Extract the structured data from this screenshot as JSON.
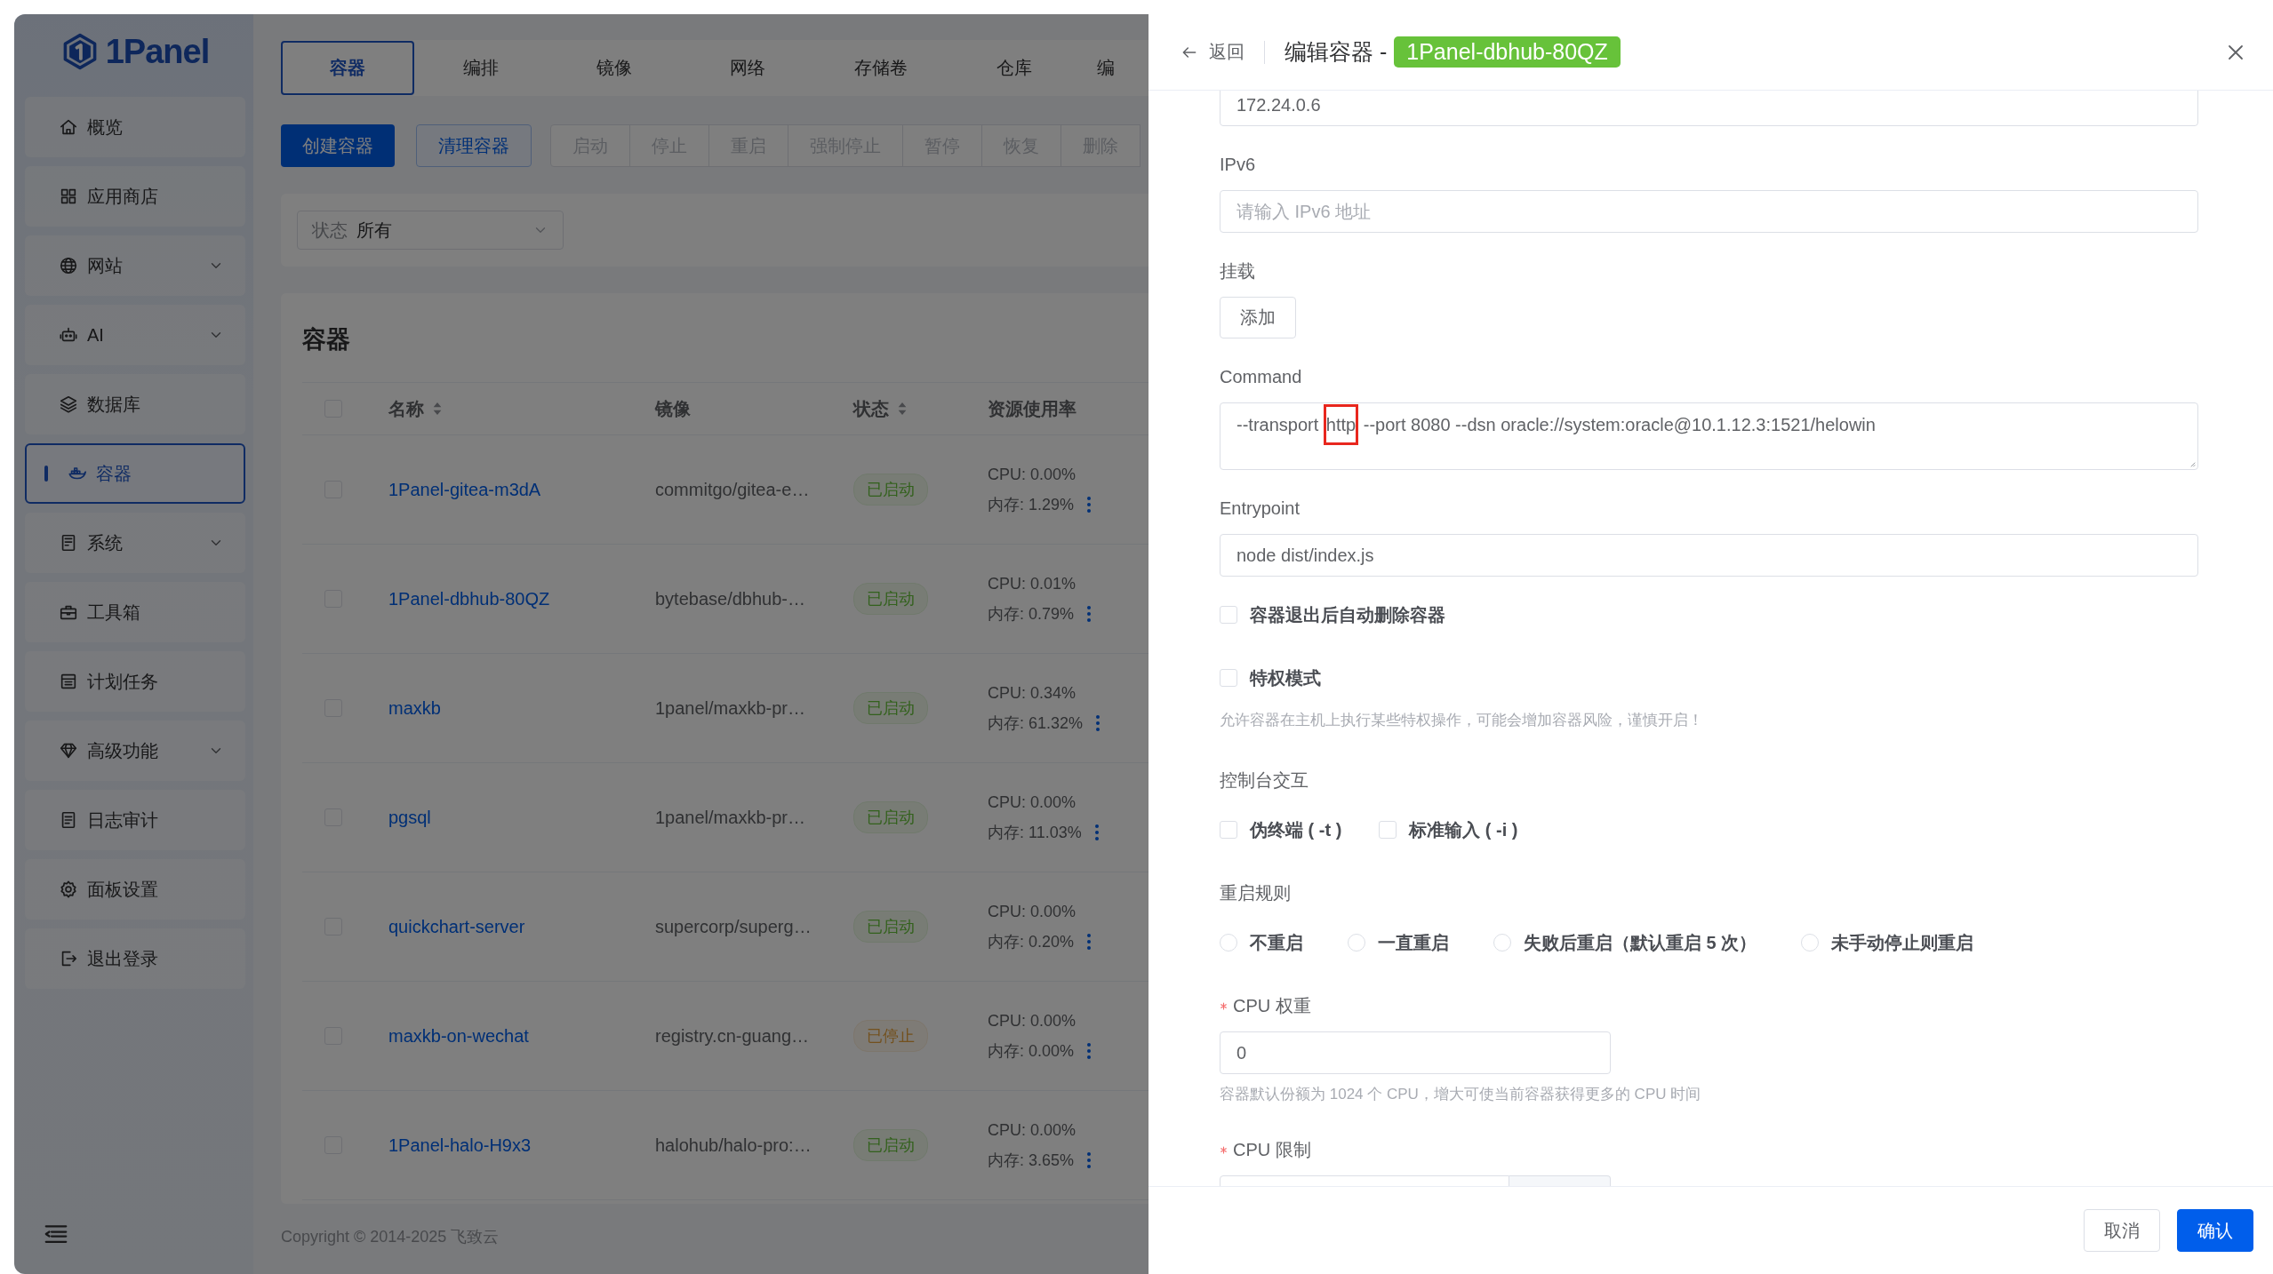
{
  "sidebar": {
    "logo": "1Panel",
    "items": [
      {
        "label": "概览",
        "expandable": false,
        "selected": false
      },
      {
        "label": "应用商店",
        "expandable": false,
        "selected": false
      },
      {
        "label": "网站",
        "expandable": true,
        "selected": false
      },
      {
        "label": "AI",
        "expandable": true,
        "selected": false
      },
      {
        "label": "数据库",
        "expandable": false,
        "selected": false
      },
      {
        "label": "容器",
        "expandable": false,
        "selected": true
      },
      {
        "label": "系统",
        "expandable": true,
        "selected": false
      },
      {
        "label": "工具箱",
        "expandable": false,
        "selected": false
      },
      {
        "label": "计划任务",
        "expandable": false,
        "selected": false
      },
      {
        "label": "高级功能",
        "expandable": true,
        "selected": false
      },
      {
        "label": "日志审计",
        "expandable": false,
        "selected": false
      },
      {
        "label": "面板设置",
        "expandable": false,
        "selected": false
      },
      {
        "label": "退出登录",
        "expandable": false,
        "selected": false
      }
    ]
  },
  "tabs": [
    {
      "label": "容器",
      "selected": true
    },
    {
      "label": "编排",
      "selected": false
    },
    {
      "label": "镜像",
      "selected": false
    },
    {
      "label": "网络",
      "selected": false
    },
    {
      "label": "存储卷",
      "selected": false
    },
    {
      "label": "仓库",
      "selected": false
    },
    {
      "label": "编",
      "selected": false
    }
  ],
  "toolbar": {
    "primary": "创建容器",
    "secondary": "清理容器",
    "actions": [
      {
        "label": "启动",
        "disabled": true
      },
      {
        "label": "停止",
        "disabled": true
      },
      {
        "label": "重启",
        "disabled": true
      },
      {
        "label": "强制停止",
        "disabled": true
      },
      {
        "label": "暂停",
        "disabled": true
      },
      {
        "label": "恢复",
        "disabled": true
      },
      {
        "label": "删除",
        "disabled": true
      }
    ]
  },
  "filter": {
    "label": "状态",
    "value": "所有"
  },
  "table": {
    "title": "容器",
    "select_all_checked": false,
    "columns": [
      {
        "label": "名称",
        "sortable": true
      },
      {
        "label": "镜像",
        "sortable": false
      },
      {
        "label": "状态",
        "sortable": true
      },
      {
        "label": "资源使用率",
        "sortable": false
      }
    ],
    "rows": [
      {
        "checked": false,
        "name": "1Panel-gitea-m3dA",
        "image": "commitgo/gitea-e…",
        "status": "已启动",
        "running": true,
        "cpu": "CPU: 0.00%",
        "memory": "内存: 1.29%"
      },
      {
        "checked": false,
        "name": "1Panel-dbhub-80QZ",
        "image": "bytebase/dbhub-…",
        "status": "已启动",
        "running": true,
        "cpu": "CPU: 0.01%",
        "memory": "内存: 0.79%"
      },
      {
        "checked": false,
        "name": "maxkb",
        "image": "1panel/maxkb-pr…",
        "status": "已启动",
        "running": true,
        "cpu": "CPU: 0.34%",
        "memory": "内存: 61.32%"
      },
      {
        "checked": false,
        "name": "pgsql",
        "image": "1panel/maxkb-pr…",
        "status": "已启动",
        "running": true,
        "cpu": "CPU: 0.00%",
        "memory": "内存: 11.03%"
      },
      {
        "checked": false,
        "name": "quickchart-server",
        "image": "supercorp/superg…",
        "status": "已启动",
        "running": true,
        "cpu": "CPU: 0.00%",
        "memory": "内存: 0.20%"
      },
      {
        "checked": false,
        "name": "maxkb-on-wechat",
        "image": "registry.cn-guang…",
        "status": "已停止",
        "running": false,
        "cpu": "CPU: 0.00%",
        "memory": "内存: 0.00%"
      },
      {
        "checked": false,
        "name": "1Panel-halo-H9x3",
        "image": "halohub/halo-pro:…",
        "status": "已启动",
        "running": true,
        "cpu": "CPU: 0.00%",
        "memory": "内存: 3.65%"
      }
    ]
  },
  "footer": {
    "copyright": "Copyright © 2014-2025 飞致云"
  },
  "drawer": {
    "back": "返回",
    "title": "编辑容器 -",
    "tag": "1Panel-dbhub-80QZ",
    "form": [
      {
        "kind": "input",
        "value": "172.24.0.6"
      },
      {
        "kind": "input",
        "label": "IPv6",
        "placeholder": "请输入 IPv6 地址"
      },
      {
        "kind": "button",
        "label": "挂载",
        "button": "添加"
      },
      {
        "kind": "textarea",
        "label": "Command",
        "segments": [
          {
            "text": "--transport ",
            "highlighted": false
          },
          {
            "text": "http",
            "highlighted": true
          },
          {
            "text": " --port 8080 --dsn oracle://system:oracle@10.1.12.3:1521/helowin",
            "highlighted": false
          }
        ]
      },
      {
        "kind": "input",
        "label": "Entrypoint",
        "value": "node dist/index.js"
      },
      {
        "kind": "checkbox",
        "options": [
          {
            "label": "容器退出后自动删除容器",
            "checked": false
          }
        ]
      },
      {
        "kind": "checkbox",
        "options": [
          {
            "label": "特权模式",
            "checked": false
          }
        ],
        "help": "允许容器在主机上执行某些特权操作，可能会增加容器风险，谨慎开启！"
      },
      {
        "kind": "checkbox",
        "label": "控制台交互",
        "options": [
          {
            "label": "伪终端 ( -t )",
            "checked": false
          },
          {
            "label": "标准输入 ( -i )",
            "checked": false
          }
        ]
      },
      {
        "kind": "radio",
        "label": "重启规则",
        "options": [
          {
            "label": "不重启",
            "selected": false
          },
          {
            "label": "一直重启",
            "selected": false
          },
          {
            "label": "失败后重启（默认重启 5 次）",
            "selected": false
          },
          {
            "label": "未手动停止则重启",
            "selected": false
          }
        ]
      },
      {
        "kind": "number",
        "label": "CPU 权重",
        "required": true,
        "value": "0",
        "help": "容器默认份额为 1024 个 CPU，增大可使当前容器获得更多的 CPU 时间"
      },
      {
        "kind": "number_unit",
        "label": "CPU 限制",
        "required": true
      }
    ],
    "buttons": [
      {
        "label": "取消",
        "kind": "default"
      },
      {
        "label": "确认",
        "kind": "primary"
      }
    ]
  }
}
